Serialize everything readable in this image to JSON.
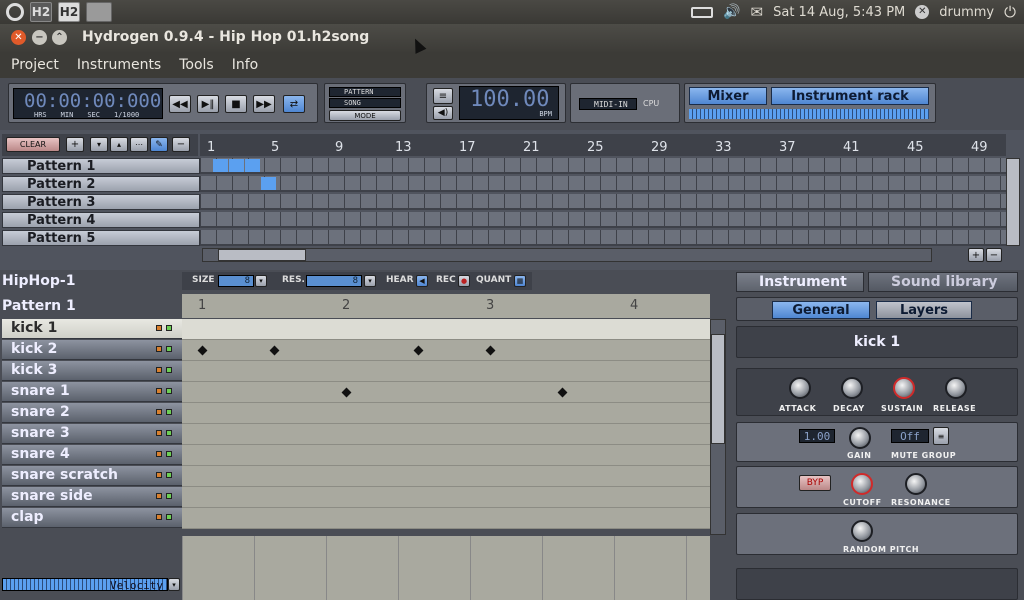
{
  "topbar": {
    "datetime": "Sat 14 Aug,  5:43 PM",
    "user": "drummy",
    "app1": "H2",
    "app2": "H2"
  },
  "window": {
    "title": "Hydrogen 0.9.4 - Hip Hop 01.h2song"
  },
  "menu": [
    "Project",
    "Instruments",
    "Tools",
    "Info"
  ],
  "transport": {
    "time": "00:00:00:000",
    "time_units": [
      "HRS",
      "MIN",
      "SEC",
      "1/1000"
    ],
    "mode_pattern": "PATTERN",
    "mode_song": "SONG",
    "mode_label": "MODE",
    "bpm": "100.00",
    "bpm_label": "BPM",
    "midi_in": "MIDI-IN",
    "cpu": "CPU",
    "mixer_btn": "Mixer",
    "rack_btn": "Instrument rack"
  },
  "song_editor": {
    "clear": "CLEAR",
    "ruler": [
      "1",
      "5",
      "9",
      "13",
      "17",
      "21",
      "25",
      "29",
      "33",
      "37",
      "41",
      "45",
      "49"
    ],
    "patterns": [
      "Pattern 1",
      "Pattern 2",
      "Pattern 3",
      "Pattern 4",
      "Pattern 5"
    ]
  },
  "pattern_editor": {
    "song_name": "HipHop-1",
    "pattern_name": "Pattern 1",
    "size_label": "SIZE",
    "size_value": "8",
    "res_label": "RES.",
    "res_value": "8",
    "hear_label": "HEAR",
    "rec_label": "REC",
    "quant_label": "QUANT",
    "beats": [
      "1",
      "2",
      "3",
      "4"
    ],
    "instruments": [
      "kick 1",
      "kick 2",
      "kick 3",
      "snare 1",
      "snare 2",
      "snare 3",
      "snare 4",
      "snare scratch",
      "snare side",
      "clap"
    ],
    "velocity_label": "Velocity"
  },
  "rack": {
    "tab_instrument": "Instrument",
    "tab_library": "Sound library",
    "tab_general": "General",
    "tab_layers": "Layers",
    "instrument_name": "kick 1",
    "attack": "ATTACK",
    "decay": "DECAY",
    "sustain": "SUSTAIN",
    "release": "RELEASE",
    "gain_value": "1.00",
    "gain": "GAIN",
    "mute_value": "Off",
    "mute_group": "MUTE GROUP",
    "byp": "BYP",
    "cutoff": "CUTOFF",
    "resonance": "RESONANCE",
    "random_pitch": "RANDOM PITCH"
  },
  "colors": {
    "accent": "#5ba0f0",
    "panel": "#4a4d55",
    "knob_red": "#d02a2a"
  }
}
